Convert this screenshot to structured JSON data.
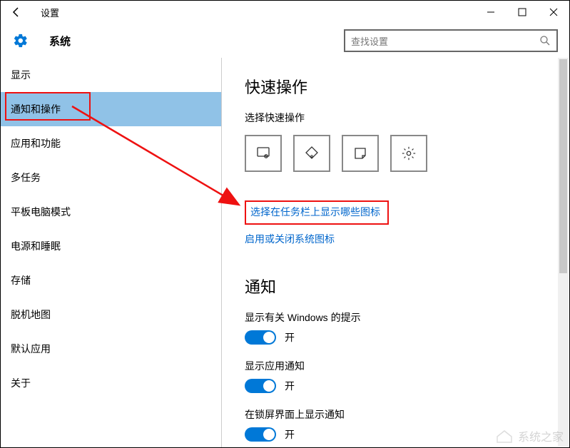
{
  "titlebar": {
    "title": "设置"
  },
  "header": {
    "page_title": "系统",
    "search_placeholder": "查找设置"
  },
  "sidebar": {
    "items": [
      {
        "label": "显示"
      },
      {
        "label": "通知和操作"
      },
      {
        "label": "应用和功能"
      },
      {
        "label": "多任务"
      },
      {
        "label": "平板电脑模式"
      },
      {
        "label": "电源和睡眠"
      },
      {
        "label": "存储"
      },
      {
        "label": "脱机地图"
      },
      {
        "label": "默认应用"
      },
      {
        "label": "关于"
      }
    ],
    "selected_index": 1
  },
  "content": {
    "quick_actions": {
      "heading": "快速操作",
      "subheading": "选择快速操作"
    },
    "links": {
      "taskbar_icons": "选择在任务栏上显示哪些图标",
      "system_icons": "启用或关闭系统图标"
    },
    "notifications": {
      "heading": "通知",
      "toggles": [
        {
          "label": "显示有关 Windows 的提示",
          "state": "开"
        },
        {
          "label": "显示应用通知",
          "state": "开"
        },
        {
          "label": "在锁屏界面上显示通知",
          "state": "开"
        }
      ]
    }
  },
  "watermark": "系统之家"
}
